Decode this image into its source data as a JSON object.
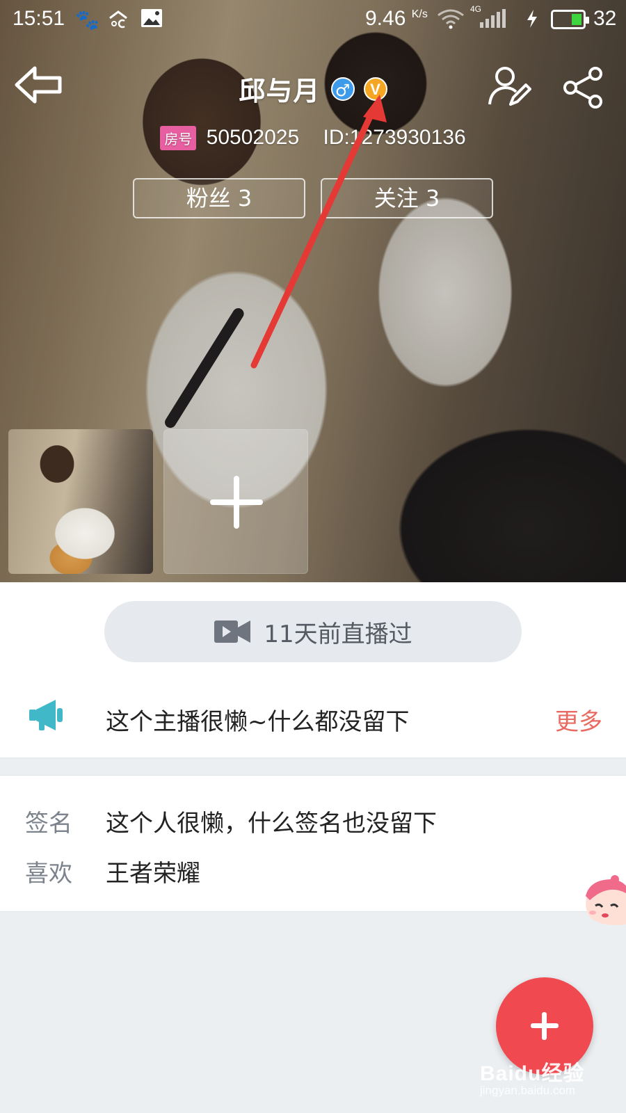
{
  "status_bar": {
    "time": "15:51",
    "net_speed": "9.46",
    "net_speed_unit": "K/s",
    "network_type": "4G",
    "battery_percent": "32",
    "icons": [
      "baidu-paw-icon",
      "weather-icon",
      "image-notification-icon",
      "wifi-icon",
      "signal-icon",
      "charging-icon",
      "battery-icon"
    ]
  },
  "header": {
    "back_icon": "back-arrow-icon",
    "nickname": "邱与月",
    "gender_symbol": "♂",
    "vip_symbol": "V",
    "edit_icon": "edit-profile-icon",
    "share_icon": "share-icon"
  },
  "room": {
    "tag": "房号",
    "number": "50502025",
    "user_id": "ID:1273930136"
  },
  "stats": {
    "fans": "粉丝 3",
    "following": "关注 3"
  },
  "gallery": {
    "add_icon": "add-photo-icon"
  },
  "live": {
    "icon": "video-camera-icon",
    "text": "11天前直播过"
  },
  "notice": {
    "icon": "megaphone-icon",
    "text": "这个主播很懒~什么都没留下",
    "more": "更多"
  },
  "info": {
    "signature_label": "签名",
    "signature_value": "这个人很懒，什么签名也没留下",
    "likes_label": "喜欢",
    "likes_value": "王者荣耀"
  },
  "fab": {
    "icon": "plus-icon"
  },
  "watermark": {
    "brand": "Baidu经验",
    "url": "jingyan.baidu.com"
  },
  "colors": {
    "accent_red": "#f0494f",
    "more_link": "#e96a60",
    "gender_blue": "#3d9be9",
    "vip_gold": "#f5a623",
    "room_tag_pink": "#e75fa0",
    "megaphone_teal": "#41b8c8",
    "annotation_arrow": "#e53935"
  }
}
